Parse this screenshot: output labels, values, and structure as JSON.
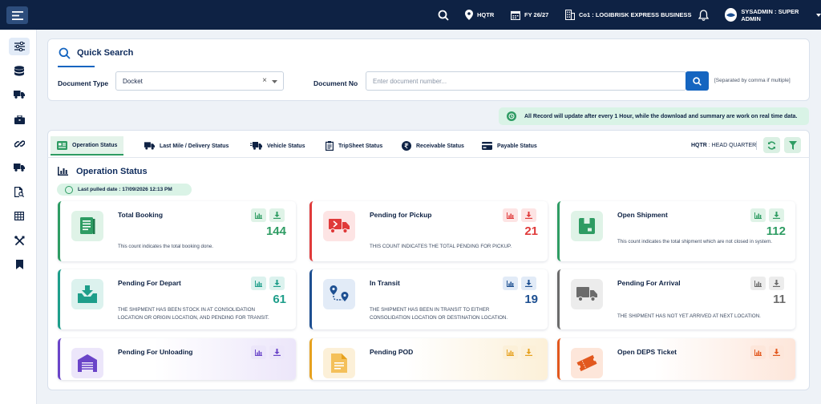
{
  "topbar": {
    "branch": "HQTR",
    "fy": "FY 26/27",
    "company": "Co1 : LOGIBRISK EXPRESS BUSINESS",
    "user": "SYSADMIN : SUPER ADMIN"
  },
  "quick_search": {
    "title": "Quick Search",
    "doc_type_label": "Document Type",
    "doc_type_value": "Docket",
    "clear_glyph": "×",
    "doc_no_label": "Document No",
    "doc_no_placeholder": "Enter document number...",
    "separator_note": "[Separated by comma if multiple]"
  },
  "notice": "All Record will update after every 1 Hour, while the download and summary are work on real time data.",
  "tabs": [
    {
      "label": "Operation Status"
    },
    {
      "label": "Last Mile / Delivery Status"
    },
    {
      "label": "Vehicle Status"
    },
    {
      "label": "TripSheet Status"
    },
    {
      "label": "Receivable Status"
    },
    {
      "label": "Payable Status"
    }
  ],
  "location": {
    "code": "HQTR",
    "name": " : HEAD QUARTER"
  },
  "section": {
    "title": "Operation Status",
    "last_pulled": "Last pulled date : 17/09/2026 12:13 PM"
  },
  "cards": [
    {
      "title": "Total Booking",
      "count": "144",
      "desc": "This count indicates the total booking done.",
      "color": "#2e9c63"
    },
    {
      "title": "Pending for Pickup",
      "count": "21",
      "desc": "THIS COUNT INDICATES THE TOTAL PENDING FOR PICKUP.",
      "color": "#e03a3a"
    },
    {
      "title": "Open Shipment",
      "count": "112",
      "desc": "This count indicates the total shipment which are not closed in system.",
      "color": "#2e9c63"
    },
    {
      "title": "Pending For Depart",
      "count": "61",
      "desc": "THE SHIPMENT HAS BEEN STOCK IN AT CONSOLIDATION LOCATION OR ORIGIN LOCATION, AND PENDING FOR TRANSIT.",
      "color": "#1e9e8a"
    },
    {
      "title": "In Transit",
      "count": "19",
      "desc": "THE SHIPMENT HAS BEEN IN TRANSIT TO EITHER CONSOLIDATION LOCATION OR DESTINATION LOCATION.",
      "color": "#1d4f91"
    },
    {
      "title": "Pending For Arrival",
      "count": "11",
      "desc": "THE SHIPMENT HAS NOT YET ARRIVED AT NEXT LOCATION.",
      "color": "#6b6b6b"
    },
    {
      "title": "Pending For Unloading",
      "count": "",
      "desc": "",
      "color": "#6a44c8"
    },
    {
      "title": "Pending POD",
      "count": "",
      "desc": "",
      "color": "#e6a11e"
    },
    {
      "title": "Open DEPS Ticket",
      "count": "",
      "desc": "",
      "color": "#e2581e"
    }
  ]
}
